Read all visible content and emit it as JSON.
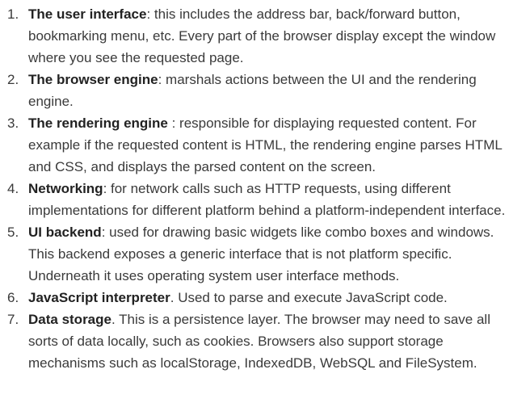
{
  "items": [
    {
      "number": "1.",
      "term": "The user interface",
      "text": ": this includes the address bar, back/forward button, bookmarking menu, etc. Every part of the browser display except the window where you see the requested page."
    },
    {
      "number": "2.",
      "term": "The browser engine",
      "text": ": marshals actions between the UI and the rendering engine."
    },
    {
      "number": "3.",
      "term": "The rendering engine",
      "text": " : responsible for displaying requested content. For example if the requested content is HTML, the rendering engine parses HTML and CSS, and displays the parsed content on the screen."
    },
    {
      "number": "4.",
      "term": "Networking",
      "text": ": for network calls such as HTTP requests, using different implementations for different platform behind a platform-independent interface."
    },
    {
      "number": "5.",
      "term": "UI backend",
      "text": ": used for drawing basic widgets like combo boxes and windows. This backend exposes a generic interface that is not platform specific. Underneath it uses operating system user interface methods."
    },
    {
      "number": "6.",
      "term": "JavaScript interpreter",
      "text": ". Used to parse and execute JavaScript code."
    },
    {
      "number": "7.",
      "term": "Data storage",
      "text": ". This is a persistence layer. The browser may need to save all sorts of data locally, such as cookies. Browsers also support storage mechanisms such as localStorage, IndexedDB, WebSQL and FileSystem."
    }
  ]
}
